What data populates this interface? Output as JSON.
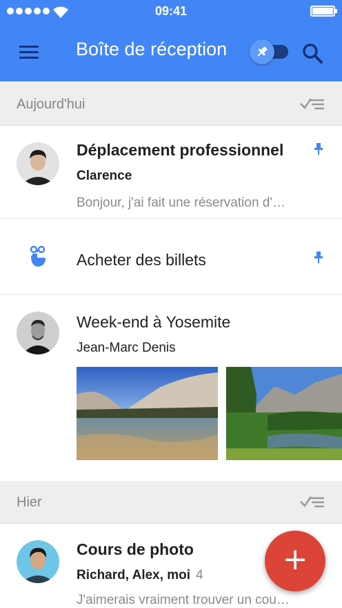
{
  "status_bar": {
    "time": "09:41"
  },
  "header": {
    "title": "Boîte de réception"
  },
  "sections": [
    {
      "label": "Aujourd'hui"
    },
    {
      "label": "Hier"
    }
  ],
  "items": [
    {
      "subject": "Déplacement professionnel",
      "sender": "Clarence",
      "preview": "Bonjour, j'ai fait une réservation d'…",
      "pinned": true
    },
    {
      "subject": "Acheter des billets",
      "type": "reminder",
      "pinned": true
    },
    {
      "subject": "Week-end à Yosemite",
      "sender": "Jean-Marc Denis",
      "attachments": [
        "yosemite-lake-photo",
        "yosemite-valley-photo"
      ]
    },
    {
      "subject": "Cours de photo",
      "sender": "Richard, Alex, moi",
      "count": "4",
      "preview": "J'aimerais vraiment trouver un cou…"
    }
  ],
  "fab": {
    "label": "+"
  },
  "colors": {
    "app_bar": "#4286f5",
    "pin": "#4286f5",
    "fab": "#db4437",
    "section_bg": "#eeeeee"
  }
}
